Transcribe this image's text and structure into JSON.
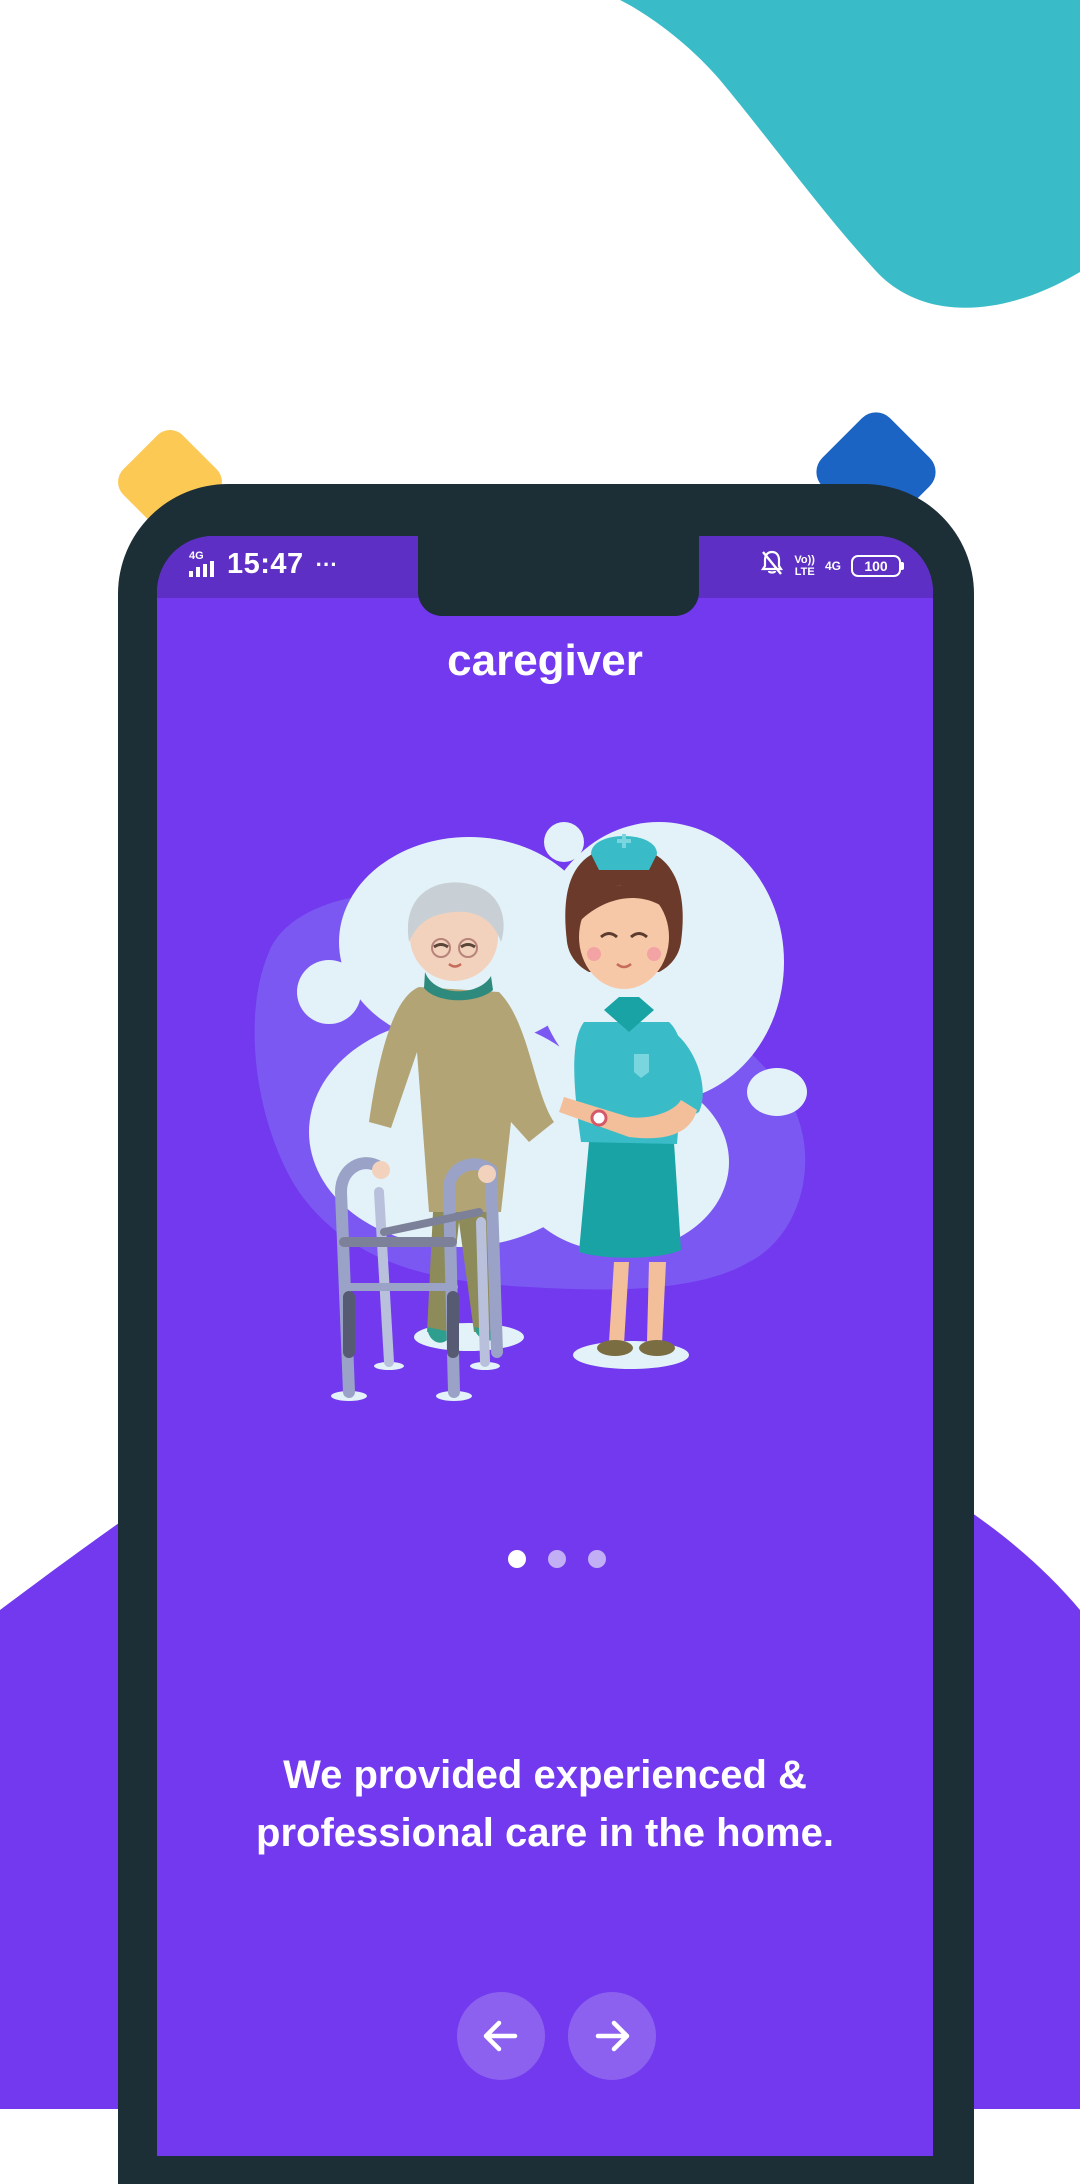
{
  "colors": {
    "primary": "#7239ee",
    "statusbar": "#5d2fc4",
    "frame": "#1c2e36",
    "teal_blob": "#3abcc8",
    "yellow_diamond": "#fbc954",
    "blue_diamond": "#1c64c3",
    "nav_button": "#8d61ef",
    "dot_inactive": "#c1aef5"
  },
  "status_bar": {
    "network_type": "4G",
    "time": "15:47",
    "more": "···",
    "volte_line1": "Vo))",
    "volte_line2": "LTE",
    "network_right": "4G",
    "battery": "100",
    "icons": [
      "signal-icon",
      "bell-off-icon",
      "battery-icon"
    ]
  },
  "app": {
    "title": "caregiver"
  },
  "onboarding": {
    "page_count": 3,
    "active_page": 1,
    "tagline": "We provided experienced & professional care in the home.",
    "illustration": "caregiver-with-elderly-woman-illustration"
  },
  "nav": {
    "prev_icon": "arrow-left-icon",
    "next_icon": "arrow-right-icon"
  }
}
